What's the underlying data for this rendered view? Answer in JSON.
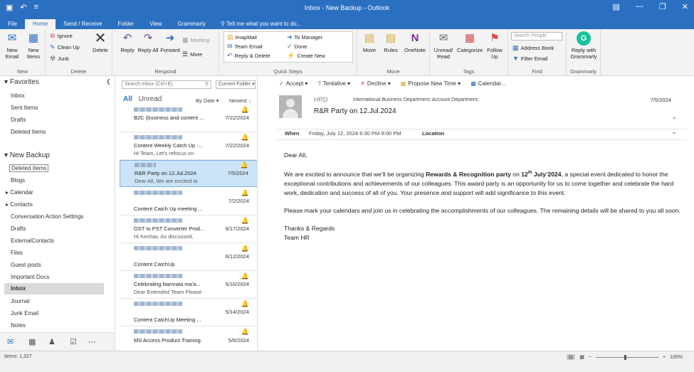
{
  "window": {
    "title": "Inbox - New Backup - Outlook"
  },
  "tabs": [
    "File",
    "Home",
    "Send / Receive",
    "Folder",
    "View",
    "Grammarly"
  ],
  "tell_me": "Tell me what you want to do...",
  "ribbon": {
    "new_email": "New Email",
    "new_items": "New Items",
    "group_new": "New",
    "ignore": "Ignore",
    "clean_up": "Clean Up",
    "junk": "Junk",
    "delete": "Delete",
    "group_delete": "Delete",
    "reply": "Reply",
    "reply_all": "Reply All",
    "forward": "Forward",
    "meeting": "Meeting",
    "more": "More",
    "group_respond": "Respond",
    "quick_steps": [
      "ImapMail",
      "To Manager",
      "Team Email",
      "Done",
      "Reply & Delete",
      "Create New"
    ],
    "group_quick_steps": "Quick Steps",
    "move": "Move",
    "rules": "Rules",
    "onenote": "OneNote",
    "group_move": "Move",
    "unread_read": "Unread/ Read",
    "categorize": "Categorize",
    "follow_up": "Follow Up",
    "group_tags": "Tags",
    "search_people": "Search People",
    "address_book": "Address Book",
    "filter_email": "Filter Email",
    "group_find": "Find",
    "reply_grammarly": "Reply with Grammarly",
    "group_grammarly": "Grammarly"
  },
  "nav": {
    "favorites_label": "Favorites",
    "favorites": [
      "Inbox",
      "Sent Items",
      "Drafts",
      "Deleted Items"
    ],
    "account_label": "New Backup",
    "folders": [
      "Deleted Items",
      "Blogs",
      "Calendar",
      "Contacts",
      "Conversation Action Settings",
      "Drafts",
      "ExternalContacts",
      "Files",
      "Guest posts",
      "Important Docs",
      "Inbox",
      "Journal",
      "Junk Email",
      "Notes"
    ],
    "selected_folder": "Inbox"
  },
  "list": {
    "search_placeholder": "Search Inbox (Ctrl+E)",
    "current_folder": "Current Folder",
    "filter_all": "All",
    "filter_unread": "Unread",
    "sort_by": "By Date",
    "sort_order": "Newest",
    "messages": [
      {
        "subject": "B2C (business and content ...",
        "preview": "",
        "date": "7/22/2024"
      },
      {
        "subject": "Content Weekly Catch Up -...",
        "preview": "Hi Team,  Let's refocus on",
        "date": "7/22/2024"
      },
      {
        "subject": "R&R Party on 12.Jul.2024",
        "preview": "Dear All,   We are excited to",
        "date": "7/5/2024"
      },
      {
        "subject": "Content Catch Up meeting ...",
        "preview": "",
        "date": "7/2/2024"
      },
      {
        "subject": "OST to PST Converter Prod...",
        "preview": "Hi Keshav,  As discussed,",
        "date": "6/17/2024"
      },
      {
        "subject": "Content CatchUp",
        "preview": "",
        "date": "6/12/2024"
      },
      {
        "subject": "Celebrating Namrata ma'a...",
        "preview": "Dear Extended Team  Please",
        "date": "5/16/2024"
      },
      {
        "subject": "Content CatchUp Meeting ...",
        "preview": "",
        "date": "5/14/2024"
      },
      {
        "subject": "MS Access Product Training",
        "preview": "",
        "date": "5/6/2024"
      }
    ]
  },
  "reading": {
    "actions": [
      "Accept",
      "Tentative",
      "Decline",
      "Propose New Time",
      "Calendar..."
    ],
    "from": "HRD",
    "to": "International Business Department; Account Department;",
    "subject": "R&R Party on 12.Jul.2024",
    "date": "7/5/2024",
    "when_label": "When",
    "when_value": "Friday, July 12, 2024 6:30 PM-9:00 PM",
    "location_label": "Location",
    "greeting": "Dear All,",
    "p1_a": "We are excited to announce that we’ll be organizing ",
    "p1_bold": "Rewards & Recognition party",
    "p1_b": " on ",
    "p1_date": "12",
    "p1_sup": "th",
    "p1_date2": " July’2024",
    "p1_c": ", a special event dedicated to honor the exceptional contributions and achievements of our colleagues. This award party is an opportunity for us to come together and celebrate the hard work, dedication and success of all of you. Your presence and support will add significance to this event.",
    "p2": "Please mark your calendars and join us in celebrating the accomplishments of our colleagues. The remaining details will be shared to you all soon.",
    "signoff": "Thanks & Regards",
    "signature": "Team HR"
  },
  "status": {
    "items": "Items: 1,327",
    "zoom": "100%"
  }
}
